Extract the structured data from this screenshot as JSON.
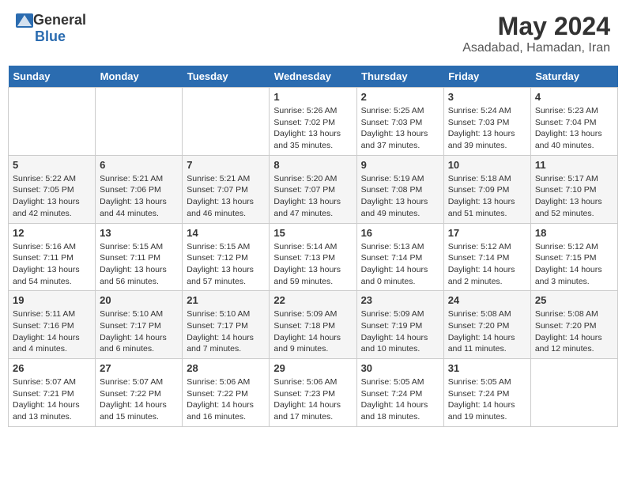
{
  "logo": {
    "general": "General",
    "blue": "Blue"
  },
  "title": {
    "month_year": "May 2024",
    "location": "Asadabad, Hamadan, Iran"
  },
  "headers": [
    "Sunday",
    "Monday",
    "Tuesday",
    "Wednesday",
    "Thursday",
    "Friday",
    "Saturday"
  ],
  "weeks": [
    [
      {
        "day": "",
        "sunrise": "",
        "sunset": "",
        "daylight": ""
      },
      {
        "day": "",
        "sunrise": "",
        "sunset": "",
        "daylight": ""
      },
      {
        "day": "",
        "sunrise": "",
        "sunset": "",
        "daylight": ""
      },
      {
        "day": "1",
        "sunrise": "Sunrise: 5:26 AM",
        "sunset": "Sunset: 7:02 PM",
        "daylight": "Daylight: 13 hours and 35 minutes."
      },
      {
        "day": "2",
        "sunrise": "Sunrise: 5:25 AM",
        "sunset": "Sunset: 7:03 PM",
        "daylight": "Daylight: 13 hours and 37 minutes."
      },
      {
        "day": "3",
        "sunrise": "Sunrise: 5:24 AM",
        "sunset": "Sunset: 7:03 PM",
        "daylight": "Daylight: 13 hours and 39 minutes."
      },
      {
        "day": "4",
        "sunrise": "Sunrise: 5:23 AM",
        "sunset": "Sunset: 7:04 PM",
        "daylight": "Daylight: 13 hours and 40 minutes."
      }
    ],
    [
      {
        "day": "5",
        "sunrise": "Sunrise: 5:22 AM",
        "sunset": "Sunset: 7:05 PM",
        "daylight": "Daylight: 13 hours and 42 minutes."
      },
      {
        "day": "6",
        "sunrise": "Sunrise: 5:21 AM",
        "sunset": "Sunset: 7:06 PM",
        "daylight": "Daylight: 13 hours and 44 minutes."
      },
      {
        "day": "7",
        "sunrise": "Sunrise: 5:21 AM",
        "sunset": "Sunset: 7:07 PM",
        "daylight": "Daylight: 13 hours and 46 minutes."
      },
      {
        "day": "8",
        "sunrise": "Sunrise: 5:20 AM",
        "sunset": "Sunset: 7:07 PM",
        "daylight": "Daylight: 13 hours and 47 minutes."
      },
      {
        "day": "9",
        "sunrise": "Sunrise: 5:19 AM",
        "sunset": "Sunset: 7:08 PM",
        "daylight": "Daylight: 13 hours and 49 minutes."
      },
      {
        "day": "10",
        "sunrise": "Sunrise: 5:18 AM",
        "sunset": "Sunset: 7:09 PM",
        "daylight": "Daylight: 13 hours and 51 minutes."
      },
      {
        "day": "11",
        "sunrise": "Sunrise: 5:17 AM",
        "sunset": "Sunset: 7:10 PM",
        "daylight": "Daylight: 13 hours and 52 minutes."
      }
    ],
    [
      {
        "day": "12",
        "sunrise": "Sunrise: 5:16 AM",
        "sunset": "Sunset: 7:11 PM",
        "daylight": "Daylight: 13 hours and 54 minutes."
      },
      {
        "day": "13",
        "sunrise": "Sunrise: 5:15 AM",
        "sunset": "Sunset: 7:11 PM",
        "daylight": "Daylight: 13 hours and 56 minutes."
      },
      {
        "day": "14",
        "sunrise": "Sunrise: 5:15 AM",
        "sunset": "Sunset: 7:12 PM",
        "daylight": "Daylight: 13 hours and 57 minutes."
      },
      {
        "day": "15",
        "sunrise": "Sunrise: 5:14 AM",
        "sunset": "Sunset: 7:13 PM",
        "daylight": "Daylight: 13 hours and 59 minutes."
      },
      {
        "day": "16",
        "sunrise": "Sunrise: 5:13 AM",
        "sunset": "Sunset: 7:14 PM",
        "daylight": "Daylight: 14 hours and 0 minutes."
      },
      {
        "day": "17",
        "sunrise": "Sunrise: 5:12 AM",
        "sunset": "Sunset: 7:14 PM",
        "daylight": "Daylight: 14 hours and 2 minutes."
      },
      {
        "day": "18",
        "sunrise": "Sunrise: 5:12 AM",
        "sunset": "Sunset: 7:15 PM",
        "daylight": "Daylight: 14 hours and 3 minutes."
      }
    ],
    [
      {
        "day": "19",
        "sunrise": "Sunrise: 5:11 AM",
        "sunset": "Sunset: 7:16 PM",
        "daylight": "Daylight: 14 hours and 4 minutes."
      },
      {
        "day": "20",
        "sunrise": "Sunrise: 5:10 AM",
        "sunset": "Sunset: 7:17 PM",
        "daylight": "Daylight: 14 hours and 6 minutes."
      },
      {
        "day": "21",
        "sunrise": "Sunrise: 5:10 AM",
        "sunset": "Sunset: 7:17 PM",
        "daylight": "Daylight: 14 hours and 7 minutes."
      },
      {
        "day": "22",
        "sunrise": "Sunrise: 5:09 AM",
        "sunset": "Sunset: 7:18 PM",
        "daylight": "Daylight: 14 hours and 9 minutes."
      },
      {
        "day": "23",
        "sunrise": "Sunrise: 5:09 AM",
        "sunset": "Sunset: 7:19 PM",
        "daylight": "Daylight: 14 hours and 10 minutes."
      },
      {
        "day": "24",
        "sunrise": "Sunrise: 5:08 AM",
        "sunset": "Sunset: 7:20 PM",
        "daylight": "Daylight: 14 hours and 11 minutes."
      },
      {
        "day": "25",
        "sunrise": "Sunrise: 5:08 AM",
        "sunset": "Sunset: 7:20 PM",
        "daylight": "Daylight: 14 hours and 12 minutes."
      }
    ],
    [
      {
        "day": "26",
        "sunrise": "Sunrise: 5:07 AM",
        "sunset": "Sunset: 7:21 PM",
        "daylight": "Daylight: 14 hours and 13 minutes."
      },
      {
        "day": "27",
        "sunrise": "Sunrise: 5:07 AM",
        "sunset": "Sunset: 7:22 PM",
        "daylight": "Daylight: 14 hours and 15 minutes."
      },
      {
        "day": "28",
        "sunrise": "Sunrise: 5:06 AM",
        "sunset": "Sunset: 7:22 PM",
        "daylight": "Daylight: 14 hours and 16 minutes."
      },
      {
        "day": "29",
        "sunrise": "Sunrise: 5:06 AM",
        "sunset": "Sunset: 7:23 PM",
        "daylight": "Daylight: 14 hours and 17 minutes."
      },
      {
        "day": "30",
        "sunrise": "Sunrise: 5:05 AM",
        "sunset": "Sunset: 7:24 PM",
        "daylight": "Daylight: 14 hours and 18 minutes."
      },
      {
        "day": "31",
        "sunrise": "Sunrise: 5:05 AM",
        "sunset": "Sunset: 7:24 PM",
        "daylight": "Daylight: 14 hours and 19 minutes."
      },
      {
        "day": "",
        "sunrise": "",
        "sunset": "",
        "daylight": ""
      }
    ]
  ]
}
